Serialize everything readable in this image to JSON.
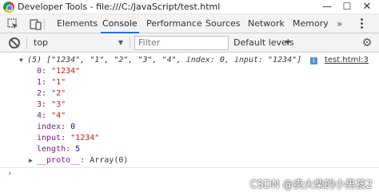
{
  "window": {
    "title": "Developer Tools - file:///C:/JavaScript/test.html",
    "minimize": "—",
    "maximize": "☐",
    "close": "✕"
  },
  "tabs": [
    "Elements",
    "Console",
    "Performance",
    "Sources",
    "Network",
    "Memory"
  ],
  "active_tab": "Console",
  "tabbar": {
    "more": "»",
    "accent_color": "#1a73e8"
  },
  "toolbar": {
    "context": "top",
    "filter_placeholder": "Filter",
    "levels": "Default levels",
    "dropdown_arrow": "▼"
  },
  "console": {
    "summary": "(5) [\"1234\", \"1\", \"2\", \"3\", \"4\", index: 0, input: \"1234\"]",
    "info_glyph": "i",
    "source": "test.html:3",
    "triangle_open": "▼",
    "triangle_closed": "▶",
    "entries": [
      {
        "key": "0",
        "value": "\"1234\"",
        "kind": "string"
      },
      {
        "key": "1",
        "value": "\"1\"",
        "kind": "string"
      },
      {
        "key": "2",
        "value": "\"2\"",
        "kind": "string"
      },
      {
        "key": "3",
        "value": "\"3\"",
        "kind": "string"
      },
      {
        "key": "4",
        "value": "\"4\"",
        "kind": "string"
      },
      {
        "key": "index",
        "value": "0",
        "kind": "number"
      },
      {
        "key": "input",
        "value": "\"1234\"",
        "kind": "string"
      },
      {
        "key": "length",
        "value": "5",
        "kind": "number"
      }
    ],
    "proto": {
      "key": "__proto__",
      "value": "Array(0)"
    },
    "prompt": "›"
  },
  "colors": {
    "key": "#881391",
    "string": "#c41a16",
    "number": "#1c00cf",
    "text": "#303942"
  },
  "watermark": "CSDN @卖火柴的小男孩2"
}
